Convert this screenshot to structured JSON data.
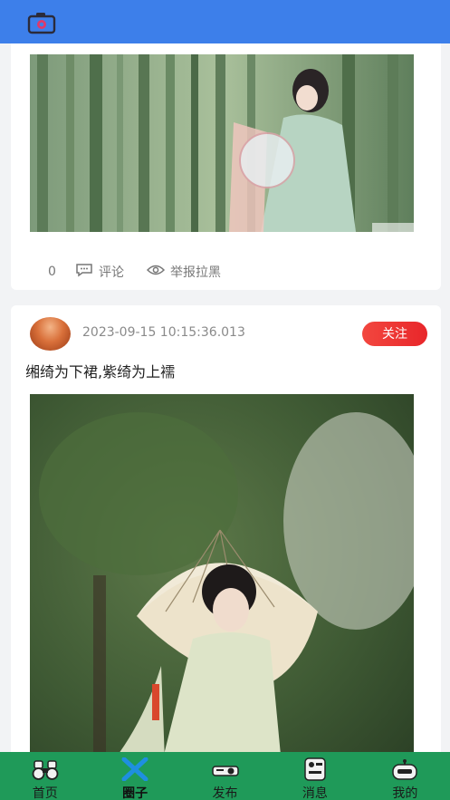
{
  "header": {
    "camera_icon": "camera-icon",
    "bg_color": "#3d7fea"
  },
  "posts": [
    {
      "photo_desc": "bamboo-forest-hanfu-fan",
      "actions": {
        "count": "0",
        "comment_label": "评论",
        "report_label": "举报拉黑"
      }
    },
    {
      "time": "2023-09-15 10:15:36.013",
      "follow_label": "关注",
      "caption": "缃绮为下裙,紫绮为上襦",
      "photo_desc": "hanfu-oil-paper-umbrella"
    }
  ],
  "bottom_nav": {
    "items": [
      {
        "label": "首页",
        "icon": "binoculars-icon"
      },
      {
        "label": "圈子",
        "icon": "cross-icon",
        "active": true
      },
      {
        "label": "发布",
        "icon": "projector-icon"
      },
      {
        "label": "消息",
        "icon": "message-icon"
      },
      {
        "label": "我的",
        "icon": "robot-icon"
      }
    ],
    "bg_color": "#1f9a59"
  }
}
